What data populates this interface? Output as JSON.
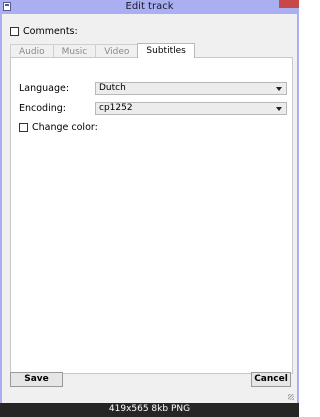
{
  "window": {
    "title": "Edit track",
    "icon": "app-document-icon",
    "close_color": "#c84848"
  },
  "comments": {
    "label": "Comments:",
    "checked": false
  },
  "tabs": [
    {
      "label": "Audio",
      "active": false
    },
    {
      "label": "Music",
      "active": false
    },
    {
      "label": "Video",
      "active": false
    },
    {
      "label": "Subtitles",
      "active": true
    }
  ],
  "subtitles": {
    "language_label": "Language:",
    "language_value": "Dutch",
    "encoding_label": "Encoding:",
    "encoding_value": "cp1252",
    "change_color_label": "Change color:",
    "change_color_checked": false
  },
  "buttons": {
    "save": "Save",
    "cancel": "Cancel"
  },
  "statusbar": {
    "text": "419x565 8kb PNG"
  }
}
